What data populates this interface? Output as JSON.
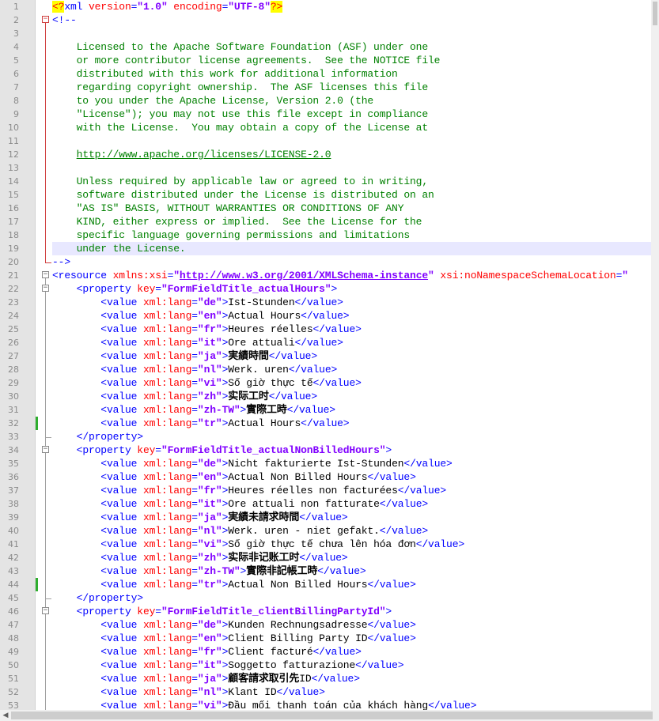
{
  "editor": {
    "highlighted_line": 19,
    "changed_lines": [
      32,
      44
    ],
    "fold_starts": {
      "2": "red",
      "21": "gray",
      "22": "gray",
      "34": "gray",
      "46": "gray"
    },
    "fold_ranges": [
      {
        "from": 2,
        "to": 20,
        "color": "red"
      },
      {
        "from": 21,
        "to": 53,
        "color": "gray"
      },
      {
        "from": 22,
        "to": 33,
        "color": "gray"
      },
      {
        "from": 34,
        "to": 45,
        "color": "gray"
      },
      {
        "from": 46,
        "to": 53,
        "color": "gray"
      }
    ],
    "lines": [
      [
        [
          "pi",
          "<?"
        ],
        [
          "tag",
          "xml "
        ],
        [
          "attr",
          "version"
        ],
        [
          "tag",
          "="
        ],
        [
          "val",
          "\"1.0\""
        ],
        [
          "tag",
          " "
        ],
        [
          "attr",
          "encoding"
        ],
        [
          "tag",
          "="
        ],
        [
          "val",
          "\"UTF-8\""
        ],
        [
          "pi",
          "?>"
        ]
      ],
      [
        [
          "tag",
          "<!--"
        ]
      ],
      [],
      [
        [
          "com",
          "    Licensed to the Apache Software Foundation (ASF) under one"
        ]
      ],
      [
        [
          "com",
          "    or more contributor license agreements.  See the NOTICE file"
        ]
      ],
      [
        [
          "com",
          "    distributed with this work for additional information"
        ]
      ],
      [
        [
          "com",
          "    regarding copyright ownership.  The ASF licenses this file"
        ]
      ],
      [
        [
          "com",
          "    to you under the Apache License, Version 2.0 (the"
        ]
      ],
      [
        [
          "com",
          "    \"License\"); you may not use this file except in compliance"
        ]
      ],
      [
        [
          "com",
          "    with the License.  You may obtain a copy of the License at"
        ]
      ],
      [],
      [
        [
          "com",
          "    "
        ],
        [
          "link",
          "http://www.apache.org/licenses/LICENSE-2.0"
        ]
      ],
      [],
      [
        [
          "com",
          "    Unless required by applicable law or agreed to in writing,"
        ]
      ],
      [
        [
          "com",
          "    software distributed under the License is distributed on an"
        ]
      ],
      [
        [
          "com",
          "    \"AS IS\" BASIS, WITHOUT WARRANTIES OR CONDITIONS OF ANY"
        ]
      ],
      [
        [
          "com",
          "    KIND, either express or implied.  See the License for the"
        ]
      ],
      [
        [
          "com",
          "    specific language governing permissions and limitations"
        ]
      ],
      [
        [
          "com",
          "    under the License."
        ]
      ],
      [
        [
          "tag",
          "-->"
        ]
      ],
      [
        [
          "tag",
          "<resource "
        ],
        [
          "attr",
          "xmlns:xsi"
        ],
        [
          "tag",
          "="
        ],
        [
          "val",
          "\""
        ],
        [
          "url",
          "http://www.w3.org/2001/XMLSchema-instance"
        ],
        [
          "val",
          "\""
        ],
        [
          "tag",
          " "
        ],
        [
          "attr",
          "xsi:noNamespaceSchemaLocation"
        ],
        [
          "tag",
          "="
        ],
        [
          "val",
          "\""
        ]
      ],
      [
        [
          "txt",
          "    "
        ],
        [
          "tag",
          "<property "
        ],
        [
          "attr",
          "key"
        ],
        [
          "tag",
          "="
        ],
        [
          "val",
          "\"FormFieldTitle_actualHours\""
        ],
        [
          "tag",
          ">"
        ]
      ],
      [
        [
          "txt",
          "        "
        ],
        [
          "tag",
          "<value "
        ],
        [
          "attr",
          "xml:lang"
        ],
        [
          "tag",
          "="
        ],
        [
          "val",
          "\"de\""
        ],
        [
          "tag",
          ">"
        ],
        [
          "txt",
          "Ist-Stunden"
        ],
        [
          "tag",
          "</value>"
        ]
      ],
      [
        [
          "txt",
          "        "
        ],
        [
          "tag",
          "<value "
        ],
        [
          "attr",
          "xml:lang"
        ],
        [
          "tag",
          "="
        ],
        [
          "val",
          "\"en\""
        ],
        [
          "tag",
          ">"
        ],
        [
          "txt",
          "Actual Hours"
        ],
        [
          "tag",
          "</value>"
        ]
      ],
      [
        [
          "txt",
          "        "
        ],
        [
          "tag",
          "<value "
        ],
        [
          "attr",
          "xml:lang"
        ],
        [
          "tag",
          "="
        ],
        [
          "val",
          "\"fr\""
        ],
        [
          "tag",
          ">"
        ],
        [
          "txt",
          "Heures réelles"
        ],
        [
          "tag",
          "</value>"
        ]
      ],
      [
        [
          "txt",
          "        "
        ],
        [
          "tag",
          "<value "
        ],
        [
          "attr",
          "xml:lang"
        ],
        [
          "tag",
          "="
        ],
        [
          "val",
          "\"it\""
        ],
        [
          "tag",
          ">"
        ],
        [
          "txt",
          "Ore attuali"
        ],
        [
          "tag",
          "</value>"
        ]
      ],
      [
        [
          "txt",
          "        "
        ],
        [
          "tag",
          "<value "
        ],
        [
          "attr",
          "xml:lang"
        ],
        [
          "tag",
          "="
        ],
        [
          "val",
          "\"ja\""
        ],
        [
          "tag",
          ">"
        ],
        [
          "cjk",
          "実績時間"
        ],
        [
          "tag",
          "</value>"
        ]
      ],
      [
        [
          "txt",
          "        "
        ],
        [
          "tag",
          "<value "
        ],
        [
          "attr",
          "xml:lang"
        ],
        [
          "tag",
          "="
        ],
        [
          "val",
          "\"nl\""
        ],
        [
          "tag",
          ">"
        ],
        [
          "txt",
          "Werk. uren"
        ],
        [
          "tag",
          "</value>"
        ]
      ],
      [
        [
          "txt",
          "        "
        ],
        [
          "tag",
          "<value "
        ],
        [
          "attr",
          "xml:lang"
        ],
        [
          "tag",
          "="
        ],
        [
          "val",
          "\"vi\""
        ],
        [
          "tag",
          ">"
        ],
        [
          "txt",
          "Số giờ thực tế"
        ],
        [
          "tag",
          "</value>"
        ]
      ],
      [
        [
          "txt",
          "        "
        ],
        [
          "tag",
          "<value "
        ],
        [
          "attr",
          "xml:lang"
        ],
        [
          "tag",
          "="
        ],
        [
          "val",
          "\"zh\""
        ],
        [
          "tag",
          ">"
        ],
        [
          "cjk",
          "实际工时"
        ],
        [
          "tag",
          "</value>"
        ]
      ],
      [
        [
          "txt",
          "        "
        ],
        [
          "tag",
          "<value "
        ],
        [
          "attr",
          "xml:lang"
        ],
        [
          "tag",
          "="
        ],
        [
          "val",
          "\"zh-TW\""
        ],
        [
          "tag",
          ">"
        ],
        [
          "cjk",
          "實際工時"
        ],
        [
          "tag",
          "</value>"
        ]
      ],
      [
        [
          "txt",
          "        "
        ],
        [
          "tag",
          "<value "
        ],
        [
          "attr",
          "xml:lang"
        ],
        [
          "tag",
          "="
        ],
        [
          "val",
          "\"tr\""
        ],
        [
          "tag",
          ">"
        ],
        [
          "txt",
          "Actual Hours"
        ],
        [
          "tag",
          "</value>"
        ]
      ],
      [
        [
          "txt",
          "    "
        ],
        [
          "tag",
          "</property>"
        ]
      ],
      [
        [
          "txt",
          "    "
        ],
        [
          "tag",
          "<property "
        ],
        [
          "attr",
          "key"
        ],
        [
          "tag",
          "="
        ],
        [
          "val",
          "\"FormFieldTitle_actualNonBilledHours\""
        ],
        [
          "tag",
          ">"
        ]
      ],
      [
        [
          "txt",
          "        "
        ],
        [
          "tag",
          "<value "
        ],
        [
          "attr",
          "xml:lang"
        ],
        [
          "tag",
          "="
        ],
        [
          "val",
          "\"de\""
        ],
        [
          "tag",
          ">"
        ],
        [
          "txt",
          "Nicht fakturierte Ist-Stunden"
        ],
        [
          "tag",
          "</value>"
        ]
      ],
      [
        [
          "txt",
          "        "
        ],
        [
          "tag",
          "<value "
        ],
        [
          "attr",
          "xml:lang"
        ],
        [
          "tag",
          "="
        ],
        [
          "val",
          "\"en\""
        ],
        [
          "tag",
          ">"
        ],
        [
          "txt",
          "Actual Non Billed Hours"
        ],
        [
          "tag",
          "</value>"
        ]
      ],
      [
        [
          "txt",
          "        "
        ],
        [
          "tag",
          "<value "
        ],
        [
          "attr",
          "xml:lang"
        ],
        [
          "tag",
          "="
        ],
        [
          "val",
          "\"fr\""
        ],
        [
          "tag",
          ">"
        ],
        [
          "txt",
          "Heures réelles non facturées"
        ],
        [
          "tag",
          "</value>"
        ]
      ],
      [
        [
          "txt",
          "        "
        ],
        [
          "tag",
          "<value "
        ],
        [
          "attr",
          "xml:lang"
        ],
        [
          "tag",
          "="
        ],
        [
          "val",
          "\"it\""
        ],
        [
          "tag",
          ">"
        ],
        [
          "txt",
          "Ore attuali non fatturate"
        ],
        [
          "tag",
          "</value>"
        ]
      ],
      [
        [
          "txt",
          "        "
        ],
        [
          "tag",
          "<value "
        ],
        [
          "attr",
          "xml:lang"
        ],
        [
          "tag",
          "="
        ],
        [
          "val",
          "\"ja\""
        ],
        [
          "tag",
          ">"
        ],
        [
          "cjk",
          "実績未請求時間"
        ],
        [
          "tag",
          "</value>"
        ]
      ],
      [
        [
          "txt",
          "        "
        ],
        [
          "tag",
          "<value "
        ],
        [
          "attr",
          "xml:lang"
        ],
        [
          "tag",
          "="
        ],
        [
          "val",
          "\"nl\""
        ],
        [
          "tag",
          ">"
        ],
        [
          "txt",
          "Werk. uren - niet gefakt."
        ],
        [
          "tag",
          "</value>"
        ]
      ],
      [
        [
          "txt",
          "        "
        ],
        [
          "tag",
          "<value "
        ],
        [
          "attr",
          "xml:lang"
        ],
        [
          "tag",
          "="
        ],
        [
          "val",
          "\"vi\""
        ],
        [
          "tag",
          ">"
        ],
        [
          "txt",
          "Số giờ thực tế chưa lên hóa đơn"
        ],
        [
          "tag",
          "</value>"
        ]
      ],
      [
        [
          "txt",
          "        "
        ],
        [
          "tag",
          "<value "
        ],
        [
          "attr",
          "xml:lang"
        ],
        [
          "tag",
          "="
        ],
        [
          "val",
          "\"zh\""
        ],
        [
          "tag",
          ">"
        ],
        [
          "cjk",
          "实际非记账工时"
        ],
        [
          "tag",
          "</value>"
        ]
      ],
      [
        [
          "txt",
          "        "
        ],
        [
          "tag",
          "<value "
        ],
        [
          "attr",
          "xml:lang"
        ],
        [
          "tag",
          "="
        ],
        [
          "val",
          "\"zh-TW\""
        ],
        [
          "tag",
          ">"
        ],
        [
          "cjk",
          "實際非記帳工時"
        ],
        [
          "tag",
          "</value>"
        ]
      ],
      [
        [
          "txt",
          "        "
        ],
        [
          "tag",
          "<value "
        ],
        [
          "attr",
          "xml:lang"
        ],
        [
          "tag",
          "="
        ],
        [
          "val",
          "\"tr\""
        ],
        [
          "tag",
          ">"
        ],
        [
          "txt",
          "Actual Non Billed Hours"
        ],
        [
          "tag",
          "</value>"
        ]
      ],
      [
        [
          "txt",
          "    "
        ],
        [
          "tag",
          "</property>"
        ]
      ],
      [
        [
          "txt",
          "    "
        ],
        [
          "tag",
          "<property "
        ],
        [
          "attr",
          "key"
        ],
        [
          "tag",
          "="
        ],
        [
          "val",
          "\"FormFieldTitle_clientBillingPartyId\""
        ],
        [
          "tag",
          ">"
        ]
      ],
      [
        [
          "txt",
          "        "
        ],
        [
          "tag",
          "<value "
        ],
        [
          "attr",
          "xml:lang"
        ],
        [
          "tag",
          "="
        ],
        [
          "val",
          "\"de\""
        ],
        [
          "tag",
          ">"
        ],
        [
          "txt",
          "Kunden Rechnungsadresse"
        ],
        [
          "tag",
          "</value>"
        ]
      ],
      [
        [
          "txt",
          "        "
        ],
        [
          "tag",
          "<value "
        ],
        [
          "attr",
          "xml:lang"
        ],
        [
          "tag",
          "="
        ],
        [
          "val",
          "\"en\""
        ],
        [
          "tag",
          ">"
        ],
        [
          "txt",
          "Client Billing Party ID"
        ],
        [
          "tag",
          "</value>"
        ]
      ],
      [
        [
          "txt",
          "        "
        ],
        [
          "tag",
          "<value "
        ],
        [
          "attr",
          "xml:lang"
        ],
        [
          "tag",
          "="
        ],
        [
          "val",
          "\"fr\""
        ],
        [
          "tag",
          ">"
        ],
        [
          "txt",
          "Client facturé"
        ],
        [
          "tag",
          "</value>"
        ]
      ],
      [
        [
          "txt",
          "        "
        ],
        [
          "tag",
          "<value "
        ],
        [
          "attr",
          "xml:lang"
        ],
        [
          "tag",
          "="
        ],
        [
          "val",
          "\"it\""
        ],
        [
          "tag",
          ">"
        ],
        [
          "txt",
          "Soggetto fatturazione"
        ],
        [
          "tag",
          "</value>"
        ]
      ],
      [
        [
          "txt",
          "        "
        ],
        [
          "tag",
          "<value "
        ],
        [
          "attr",
          "xml:lang"
        ],
        [
          "tag",
          "="
        ],
        [
          "val",
          "\"ja\""
        ],
        [
          "tag",
          ">"
        ],
        [
          "cjk",
          "顧客請求取引先"
        ],
        [
          "txt",
          "ID"
        ],
        [
          "tag",
          "</value>"
        ]
      ],
      [
        [
          "txt",
          "        "
        ],
        [
          "tag",
          "<value "
        ],
        [
          "attr",
          "xml:lang"
        ],
        [
          "tag",
          "="
        ],
        [
          "val",
          "\"nl\""
        ],
        [
          "tag",
          ">"
        ],
        [
          "txt",
          "Klant ID"
        ],
        [
          "tag",
          "</value>"
        ]
      ],
      [
        [
          "txt",
          "        "
        ],
        [
          "tag",
          "<value "
        ],
        [
          "attr",
          "xml:lang"
        ],
        [
          "tag",
          "="
        ],
        [
          "val",
          "\"vi\""
        ],
        [
          "tag",
          ">"
        ],
        [
          "txt",
          "Đầu mối thanh toán của khách hàng"
        ],
        [
          "tag",
          "</value>"
        ]
      ]
    ]
  }
}
